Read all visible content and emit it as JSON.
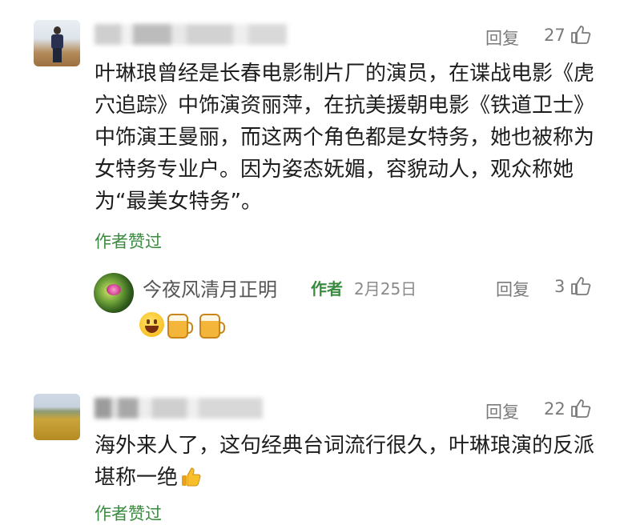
{
  "comments": [
    {
      "reply_label": "回复",
      "likes": "27",
      "text": "叶琳琅曾经是长春电影制片厂的演员，在谍战电影《虎穴追踪》中饰演资丽萍，在抗美援朝电影《铁道卫士》中饰演王曼丽，而这两个角色都是女特务，她也被称为女特务专业户。因为姿态妩媚，容貌动人，观众称她为“最美女特务”。",
      "author_liked": "作者赞过",
      "reply": {
        "username": "今夜风清月正明",
        "author_tag": "作者",
        "date": "2月25日",
        "reply_label": "回复",
        "likes": "3",
        "emojis": [
          "grinning-face",
          "beer-mug",
          "beer-mug"
        ]
      }
    },
    {
      "reply_label": "回复",
      "likes": "22",
      "text": "海外来人了，这句经典台词流行很久，叶琳琅演的反派堪称一绝",
      "text_emoji": "thumbs-up",
      "author_liked": "作者赞过"
    }
  ],
  "colors": {
    "accent_green": "#3a8b3f",
    "meta_gray": "#7a7a7a",
    "text": "#1d1d1d"
  }
}
